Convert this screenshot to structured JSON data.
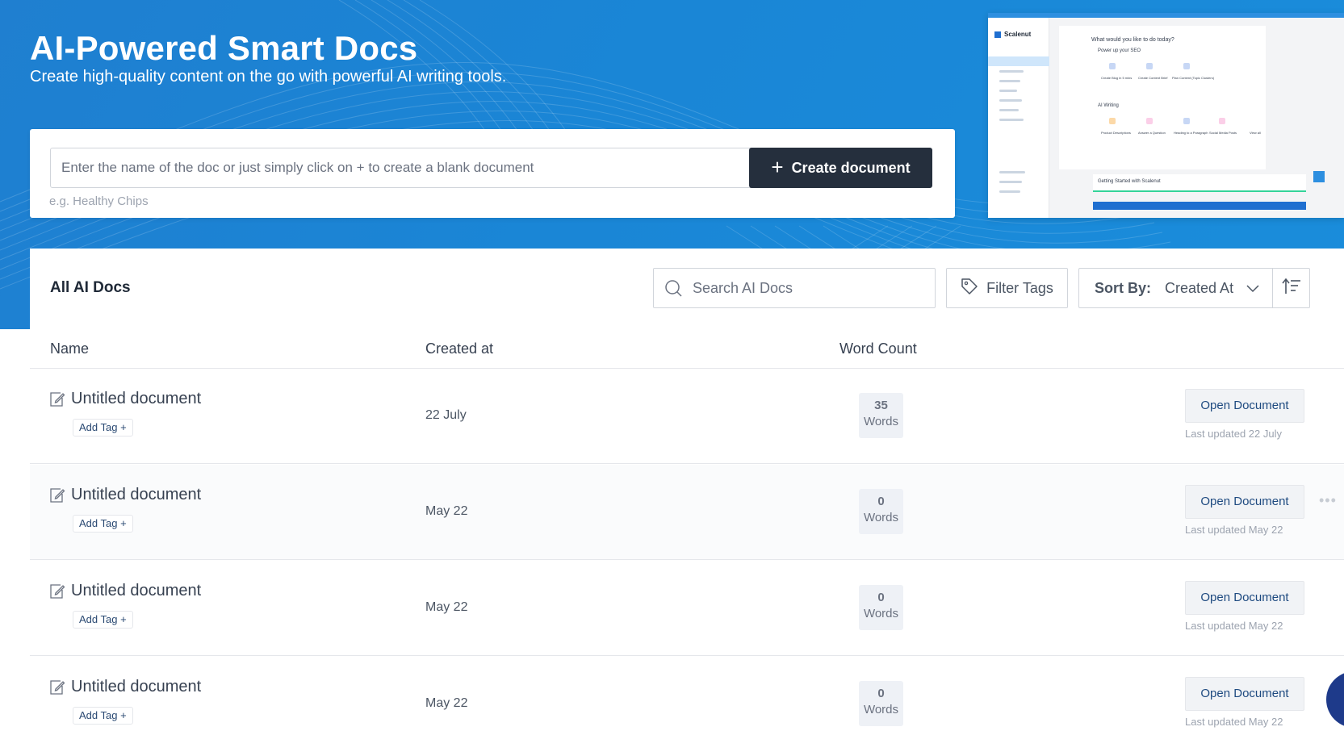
{
  "hero": {
    "title": "AI-Powered Smart Docs",
    "subtitle": "Create high-quality content on the go with powerful AI writing tools.",
    "input_placeholder": "Enter the name of the doc or just simply click on + to create a blank document",
    "example": "e.g. Healthy Chips",
    "create_button": "Create document"
  },
  "preview": {
    "brand": "Scalenut",
    "question": "What would you like to do today?",
    "section_seo": "Power up your SEO",
    "section_ai": "AI Writing",
    "seo_items": [
      "Create Blog in 5 mins",
      "Create Content Brief",
      "Plan Content (Topic Clusters)"
    ],
    "ai_items": [
      "Product Descriptions",
      "Answer a Question",
      "Heading to a Paragraph",
      "Social Media Posts",
      "View all"
    ],
    "getting_started": "Getting Started with Scalenut"
  },
  "list": {
    "title": "All AI Docs",
    "search_placeholder": "Search AI Docs",
    "filter_label": "Filter Tags",
    "sort_label": "Sort By:",
    "sort_value": "Created At",
    "columns": {
      "name": "Name",
      "created": "Created at",
      "words": "Word Count"
    },
    "rows": [
      {
        "name": "Untitled document",
        "tag": "Add Tag +",
        "created": "22 July",
        "words": "35",
        "words_unit": "Words",
        "open": "Open Document",
        "updated": "Last updated 22 July"
      },
      {
        "name": "Untitled document",
        "tag": "Add Tag +",
        "created": "May 22",
        "words": "0",
        "words_unit": "Words",
        "open": "Open Document",
        "updated": "Last updated May 22"
      },
      {
        "name": "Untitled document",
        "tag": "Add Tag +",
        "created": "May 22",
        "words": "0",
        "words_unit": "Words",
        "open": "Open Document",
        "updated": "Last updated May 22"
      },
      {
        "name": "Untitled document",
        "tag": "Add Tag +",
        "created": "May 22",
        "words": "0",
        "words_unit": "Words",
        "open": "Open Document",
        "updated": "Last updated May 22"
      }
    ]
  },
  "icons": {
    "create": "plus-icon",
    "search": "search-icon",
    "filter": "tag-icon",
    "sort": "chevron-down-icon",
    "sort_direction": "sort-ascending-icon",
    "doc": "edit-document-icon",
    "more": "more-horizontal-icon",
    "chat": "chat-icon"
  },
  "colors": {
    "hero_blue": "#1a86d6",
    "primary_button": "#252f3d",
    "link_text": "#1e4a80"
  }
}
